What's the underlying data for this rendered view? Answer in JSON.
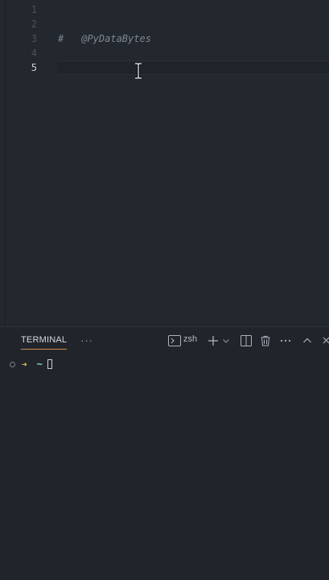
{
  "editor": {
    "line_numbers": [
      "1",
      "2",
      "3",
      "4",
      "5"
    ],
    "active_line": "5",
    "comment_hash": "#",
    "comment_text": "@PyDataBytes"
  },
  "panel": {
    "tab_label": "TERMINAL",
    "more_label": "···",
    "shell_name": "zsh",
    "prompt_arrow": "➜",
    "prompt_dir": "~"
  },
  "icons": {
    "terminal": "terminal-icon",
    "add": "plus-icon",
    "dropdown": "chevron-down-icon",
    "split": "split-icon",
    "trash": "trash-icon",
    "more": "ellipsis-icon",
    "maximize": "chevron-up-icon",
    "close": "close-icon"
  },
  "colors": {
    "editor_bg": "#23272e",
    "panel_bg": "#21252b",
    "tab_underline": "#d18a4a",
    "prompt_arrow": "#d8c656",
    "prompt_dir": "#7fd7c4"
  }
}
